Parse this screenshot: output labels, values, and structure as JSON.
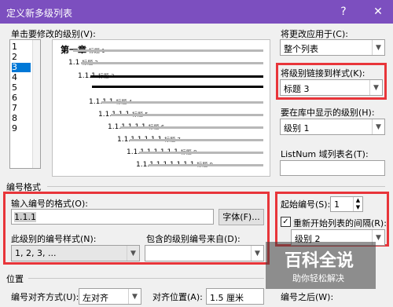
{
  "dialog": {
    "title": "定义新多级列表",
    "help_glyph": "?",
    "close_glyph": "✕"
  },
  "level_select": {
    "label": "单击要修改的级别(V):",
    "levels": [
      "1",
      "2",
      "3",
      "4",
      "5",
      "6",
      "7",
      "8",
      "9"
    ],
    "selected": "3"
  },
  "preview": {
    "rows": [
      {
        "num": "第一章",
        "name": "标题 1"
      },
      {
        "num": "1.1",
        "name": "标题 2"
      },
      {
        "num": "1.1.1",
        "name": "标题 3"
      },
      {
        "num": "1.1.1.1",
        "name": "标题 4"
      },
      {
        "num": "1.1.1.1.1",
        "name": "标题 5"
      },
      {
        "num": "1.1.1.1.1.1",
        "name": "标题 6"
      },
      {
        "num": "1.1.1.1.1.1.1",
        "name": "标题 7"
      },
      {
        "num": "1.1.1.1.1.1.1.1",
        "name": "标题 8"
      },
      {
        "num": "1.1.1.1.1.1.1.1.1",
        "name": "标题 9"
      }
    ]
  },
  "apply_to": {
    "label": "将更改应用于(C):",
    "value": "整个列表"
  },
  "link_style": {
    "label": "将级别链接到样式(K):",
    "value": "标题 3"
  },
  "gallery_level": {
    "label": "要在库中显示的级别(H):",
    "value": "级别 1"
  },
  "listnum": {
    "label": "ListNum 域列表名(T):",
    "value": ""
  },
  "number_format": {
    "section": "编号格式",
    "format_label": "输入编号的格式(O):",
    "format_value": "1.1.1",
    "font_button": "字体(F)...",
    "style_label": "此级别的编号样式(N):",
    "style_value": "1, 2, 3, ...",
    "include_label": "包含的级别编号来自(D):",
    "include_value": "",
    "start_label": "起始编号(S):",
    "start_value": "1",
    "restart_label": "重新开始列表的间隔(R):",
    "restart_checked": true,
    "restart_value": "级别 2"
  },
  "position": {
    "section": "位置",
    "align_label": "编号对齐方式(U):",
    "align_value": "左对齐",
    "align_pos_label": "对齐位置(A):",
    "align_pos_value": "1.5 厘米",
    "follow_label": "编号之后(W):"
  },
  "watermark": {
    "title": "百科全说",
    "subtitle": "助你轻松解决"
  },
  "colors": {
    "titlebar": "#7c4fbf",
    "highlight": "#e8353a",
    "selection": "#0078d7"
  }
}
